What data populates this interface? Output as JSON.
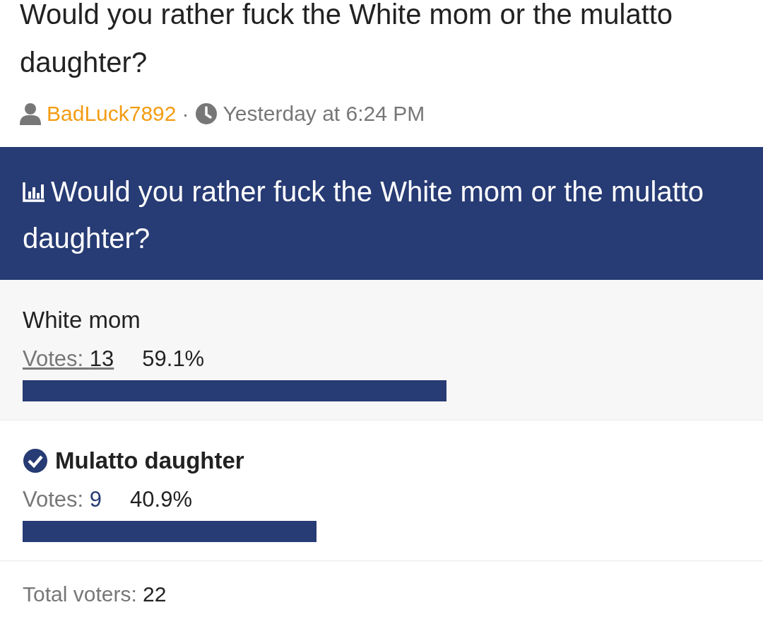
{
  "thread": {
    "title": "Would you rather fuck the White mom or the mulatto daughter?",
    "author": "BadLuck7892",
    "separator": "·",
    "time": "Yesterday at 6:24 PM"
  },
  "poll": {
    "title": "Would you rather fuck the White mom or the mulatto daughter?",
    "options": [
      {
        "label": "White mom",
        "votes_label": "Votes:",
        "votes": "13",
        "percent": "59.1%",
        "selected": false,
        "hovered": true
      },
      {
        "label": "Mulatto daughter",
        "votes_label": "Votes:",
        "votes": "9",
        "percent": "40.9%",
        "selected": true,
        "hovered": false
      }
    ],
    "total_label": "Total voters:",
    "total": "22"
  }
}
